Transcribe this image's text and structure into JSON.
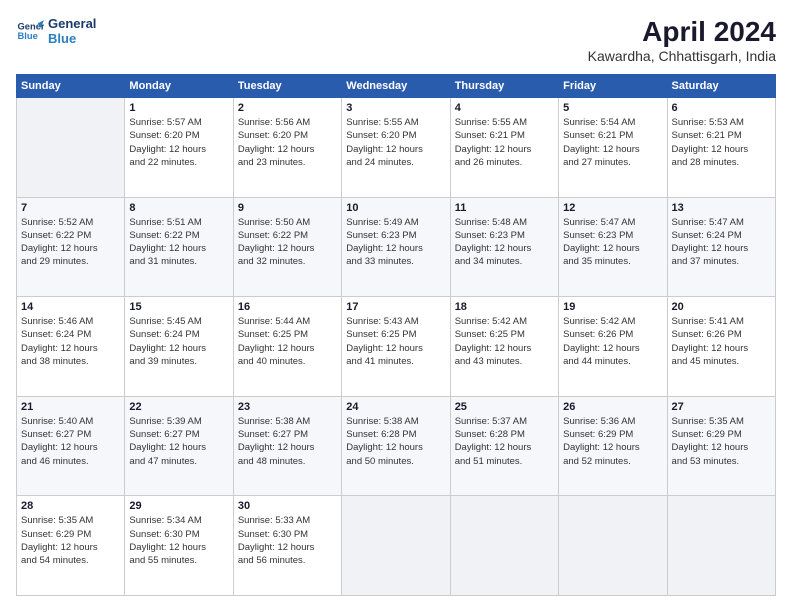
{
  "logo": {
    "line1": "General",
    "line2": "Blue"
  },
  "title": "April 2024",
  "subtitle": "Kawardha, Chhattisgarh, India",
  "header": {
    "days": [
      "Sunday",
      "Monday",
      "Tuesday",
      "Wednesday",
      "Thursday",
      "Friday",
      "Saturday"
    ]
  },
  "weeks": [
    [
      {
        "day": "",
        "info": ""
      },
      {
        "day": "1",
        "info": "Sunrise: 5:57 AM\nSunset: 6:20 PM\nDaylight: 12 hours\nand 22 minutes."
      },
      {
        "day": "2",
        "info": "Sunrise: 5:56 AM\nSunset: 6:20 PM\nDaylight: 12 hours\nand 23 minutes."
      },
      {
        "day": "3",
        "info": "Sunrise: 5:55 AM\nSunset: 6:20 PM\nDaylight: 12 hours\nand 24 minutes."
      },
      {
        "day": "4",
        "info": "Sunrise: 5:55 AM\nSunset: 6:21 PM\nDaylight: 12 hours\nand 26 minutes."
      },
      {
        "day": "5",
        "info": "Sunrise: 5:54 AM\nSunset: 6:21 PM\nDaylight: 12 hours\nand 27 minutes."
      },
      {
        "day": "6",
        "info": "Sunrise: 5:53 AM\nSunset: 6:21 PM\nDaylight: 12 hours\nand 28 minutes."
      }
    ],
    [
      {
        "day": "7",
        "info": "Sunrise: 5:52 AM\nSunset: 6:22 PM\nDaylight: 12 hours\nand 29 minutes."
      },
      {
        "day": "8",
        "info": "Sunrise: 5:51 AM\nSunset: 6:22 PM\nDaylight: 12 hours\nand 31 minutes."
      },
      {
        "day": "9",
        "info": "Sunrise: 5:50 AM\nSunset: 6:22 PM\nDaylight: 12 hours\nand 32 minutes."
      },
      {
        "day": "10",
        "info": "Sunrise: 5:49 AM\nSunset: 6:23 PM\nDaylight: 12 hours\nand 33 minutes."
      },
      {
        "day": "11",
        "info": "Sunrise: 5:48 AM\nSunset: 6:23 PM\nDaylight: 12 hours\nand 34 minutes."
      },
      {
        "day": "12",
        "info": "Sunrise: 5:47 AM\nSunset: 6:23 PM\nDaylight: 12 hours\nand 35 minutes."
      },
      {
        "day": "13",
        "info": "Sunrise: 5:47 AM\nSunset: 6:24 PM\nDaylight: 12 hours\nand 37 minutes."
      }
    ],
    [
      {
        "day": "14",
        "info": "Sunrise: 5:46 AM\nSunset: 6:24 PM\nDaylight: 12 hours\nand 38 minutes."
      },
      {
        "day": "15",
        "info": "Sunrise: 5:45 AM\nSunset: 6:24 PM\nDaylight: 12 hours\nand 39 minutes."
      },
      {
        "day": "16",
        "info": "Sunrise: 5:44 AM\nSunset: 6:25 PM\nDaylight: 12 hours\nand 40 minutes."
      },
      {
        "day": "17",
        "info": "Sunrise: 5:43 AM\nSunset: 6:25 PM\nDaylight: 12 hours\nand 41 minutes."
      },
      {
        "day": "18",
        "info": "Sunrise: 5:42 AM\nSunset: 6:25 PM\nDaylight: 12 hours\nand 43 minutes."
      },
      {
        "day": "19",
        "info": "Sunrise: 5:42 AM\nSunset: 6:26 PM\nDaylight: 12 hours\nand 44 minutes."
      },
      {
        "day": "20",
        "info": "Sunrise: 5:41 AM\nSunset: 6:26 PM\nDaylight: 12 hours\nand 45 minutes."
      }
    ],
    [
      {
        "day": "21",
        "info": "Sunrise: 5:40 AM\nSunset: 6:27 PM\nDaylight: 12 hours\nand 46 minutes."
      },
      {
        "day": "22",
        "info": "Sunrise: 5:39 AM\nSunset: 6:27 PM\nDaylight: 12 hours\nand 47 minutes."
      },
      {
        "day": "23",
        "info": "Sunrise: 5:38 AM\nSunset: 6:27 PM\nDaylight: 12 hours\nand 48 minutes."
      },
      {
        "day": "24",
        "info": "Sunrise: 5:38 AM\nSunset: 6:28 PM\nDaylight: 12 hours\nand 50 minutes."
      },
      {
        "day": "25",
        "info": "Sunrise: 5:37 AM\nSunset: 6:28 PM\nDaylight: 12 hours\nand 51 minutes."
      },
      {
        "day": "26",
        "info": "Sunrise: 5:36 AM\nSunset: 6:29 PM\nDaylight: 12 hours\nand 52 minutes."
      },
      {
        "day": "27",
        "info": "Sunrise: 5:35 AM\nSunset: 6:29 PM\nDaylight: 12 hours\nand 53 minutes."
      }
    ],
    [
      {
        "day": "28",
        "info": "Sunrise: 5:35 AM\nSunset: 6:29 PM\nDaylight: 12 hours\nand 54 minutes."
      },
      {
        "day": "29",
        "info": "Sunrise: 5:34 AM\nSunset: 6:30 PM\nDaylight: 12 hours\nand 55 minutes."
      },
      {
        "day": "30",
        "info": "Sunrise: 5:33 AM\nSunset: 6:30 PM\nDaylight: 12 hours\nand 56 minutes."
      },
      {
        "day": "",
        "info": ""
      },
      {
        "day": "",
        "info": ""
      },
      {
        "day": "",
        "info": ""
      },
      {
        "day": "",
        "info": ""
      }
    ]
  ]
}
